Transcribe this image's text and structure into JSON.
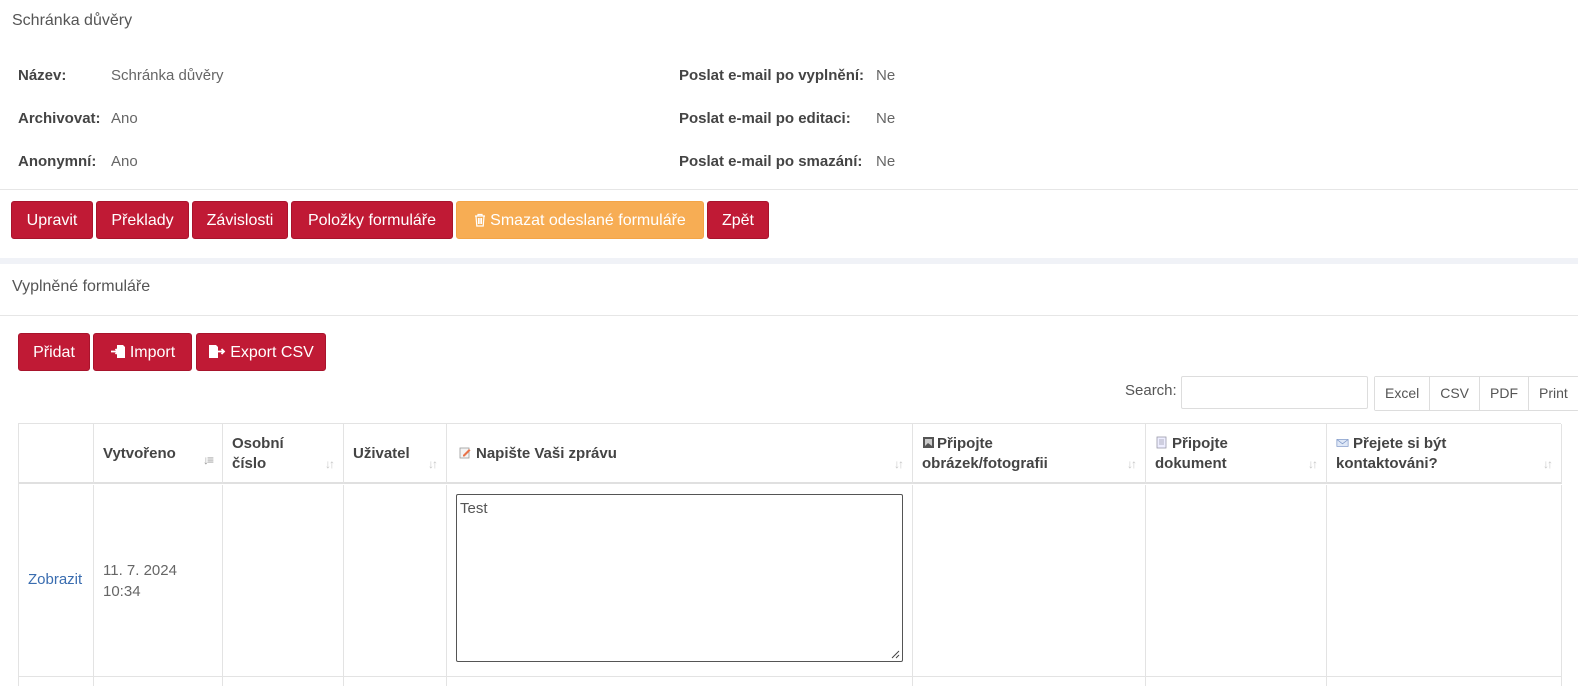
{
  "detail": {
    "title": "Schránka důvěry",
    "fields_left": [
      {
        "label": "Název:",
        "value": "Schránka důvěry"
      },
      {
        "label": "Archivovat:",
        "value": "Ano"
      },
      {
        "label": "Anonymní:",
        "value": "Ano"
      }
    ],
    "fields_right": [
      {
        "label": "Poslat e-mail po vyplnění:",
        "value": "Ne"
      },
      {
        "label": "Poslat e-mail po editaci:",
        "value": "Ne"
      },
      {
        "label": "Poslat e-mail po smazání:",
        "value": "Ne"
      }
    ],
    "buttons": {
      "edit": "Upravit",
      "translations": "Překlady",
      "dependencies": "Závislosti",
      "form_items": "Položky formuláře",
      "delete_submitted": "Smazat odeslané formuláře",
      "back": "Zpět"
    },
    "colors": {
      "primary": "#c01a35",
      "warning": "#f7ad54",
      "link": "#3a6db0"
    }
  },
  "submissions": {
    "title": "Vyplněné formuláře",
    "toolbar": {
      "add": "Přidat",
      "import": "Import",
      "export_csv": "Export CSV"
    },
    "search_label": "Search:",
    "search_value": "",
    "export_buttons": [
      "Excel",
      "CSV",
      "PDF",
      "Print"
    ],
    "columns": [
      {
        "label": "",
        "icon": ""
      },
      {
        "label": "Vytvořeno",
        "icon": "",
        "sorted": "desc"
      },
      {
        "label": "Osobní číslo",
        "icon": ""
      },
      {
        "label": "Uživatel",
        "icon": ""
      },
      {
        "label": "Napište Vaši zprávu",
        "icon": "memo-icon"
      },
      {
        "label": "Připojte obrázek/fotografii",
        "icon": "picture-icon"
      },
      {
        "label": "Připojte dokument",
        "icon": "document-icon"
      },
      {
        "label": "Přejete si být kontaktováni?",
        "icon": "envelope-icon"
      }
    ],
    "rows": [
      {
        "action": "Zobrazit",
        "created_date": "11. 7. 2024",
        "created_time": "10:34",
        "personal_number": "",
        "user": "",
        "message": "Test",
        "image": "",
        "document": "",
        "contact": ""
      }
    ]
  }
}
